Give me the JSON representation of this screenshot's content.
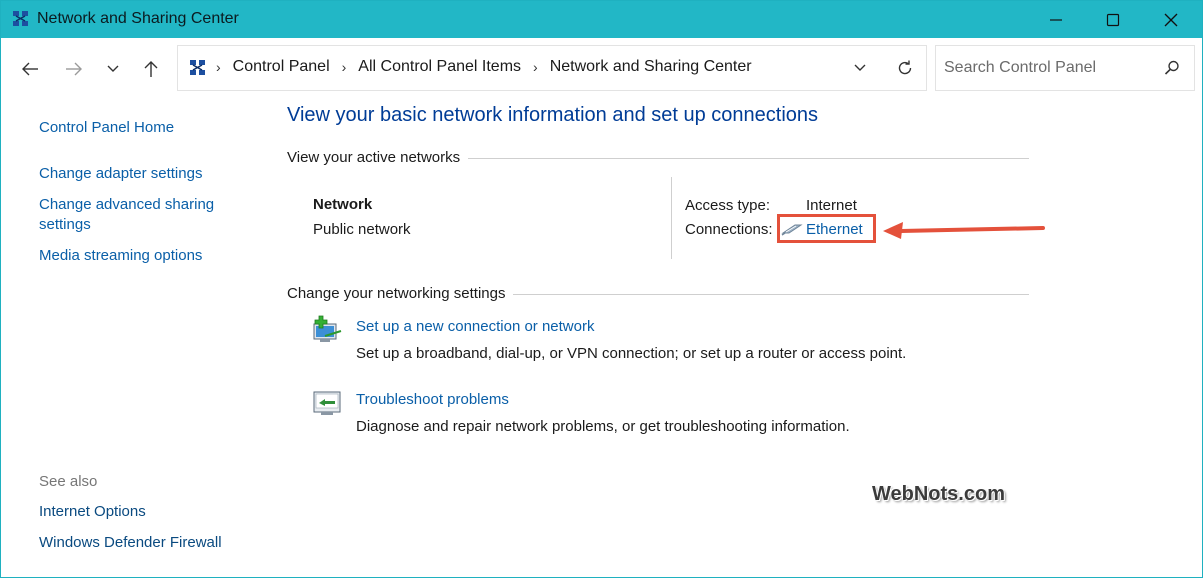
{
  "window": {
    "title": "Network and Sharing Center",
    "accent_color": "#22b7c6"
  },
  "address": {
    "crumbs": [
      "Control Panel",
      "All Control Panel Items",
      "Network and Sharing Center"
    ],
    "search_placeholder": "Search Control Panel"
  },
  "sidebar": {
    "home": "Control Panel Home",
    "links": [
      "Change adapter settings",
      "Change advanced sharing",
      "settings",
      "Media streaming options"
    ],
    "see_also_label": "See also",
    "see_also": [
      "Internet Options",
      "Windows Defender Firewall"
    ]
  },
  "main": {
    "title": "View your basic network information and set up connections",
    "active_networks_heading": "View your active networks",
    "network_name": "Network",
    "network_type": "Public network",
    "access_type_label": "Access type:",
    "access_type_value": "Internet",
    "connections_label": "Connections:",
    "connection_name": "Ethernet",
    "change_settings_heading": "Change your networking settings",
    "tasks": [
      {
        "title": "Set up a new connection or network",
        "desc": "Set up a broadband, dial-up, or VPN connection; or set up a router or access point.",
        "icon": "new-connection-icon"
      },
      {
        "title": "Troubleshoot problems",
        "desc": "Diagnose and repair network problems, or get troubleshooting information.",
        "icon": "troubleshoot-icon"
      }
    ]
  },
  "annotation": {
    "highlight_color": "#e4513b",
    "watermark": "WebNots.com"
  }
}
